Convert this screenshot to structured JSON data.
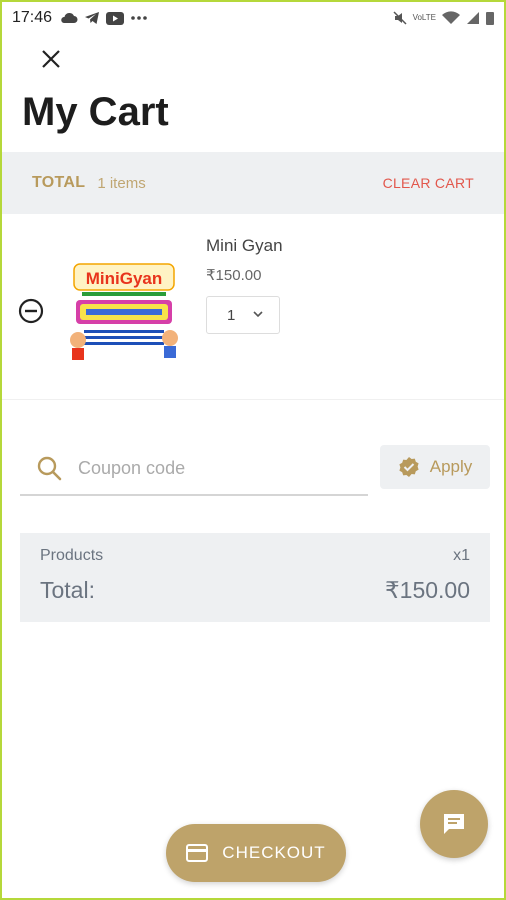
{
  "status_bar": {
    "time": "17:46",
    "left_icons": [
      "cloud-icon",
      "telegram-icon",
      "youtube-icon",
      "more-dots-icon"
    ],
    "right_icons": [
      "mute-icon",
      "volte-icon",
      "wifi-icon",
      "signal-icon",
      "battery-icon"
    ],
    "volte_label": "VoLTE"
  },
  "header": {
    "close_icon": "close-icon",
    "title": "My Cart"
  },
  "total_bar": {
    "label": "TOTAL",
    "item_count": "1 items",
    "clear_label": "CLEAR CART"
  },
  "cart": {
    "items": [
      {
        "name": "Mini Gyan",
        "price": "₹150.00",
        "quantity": "1",
        "image_text": "MiniGyan",
        "remove_icon": "minus-circle-icon"
      }
    ]
  },
  "coupon": {
    "placeholder": "Coupon code",
    "value": "",
    "apply_label": "Apply",
    "search_icon": "search-icon",
    "apply_icon": "verified-badge-icon"
  },
  "summary": {
    "products_label": "Products",
    "products_qty": "x1",
    "total_label": "Total:",
    "total_value": "₹150.00"
  },
  "checkout": {
    "label": "CHECKOUT",
    "icon": "credit-card-icon"
  },
  "chat": {
    "icon": "chat-icon"
  },
  "colors": {
    "accent": "#bea36a",
    "accent_text": "#b89a5c",
    "danger": "#e2574c",
    "panel_bg": "#eef0f2"
  }
}
